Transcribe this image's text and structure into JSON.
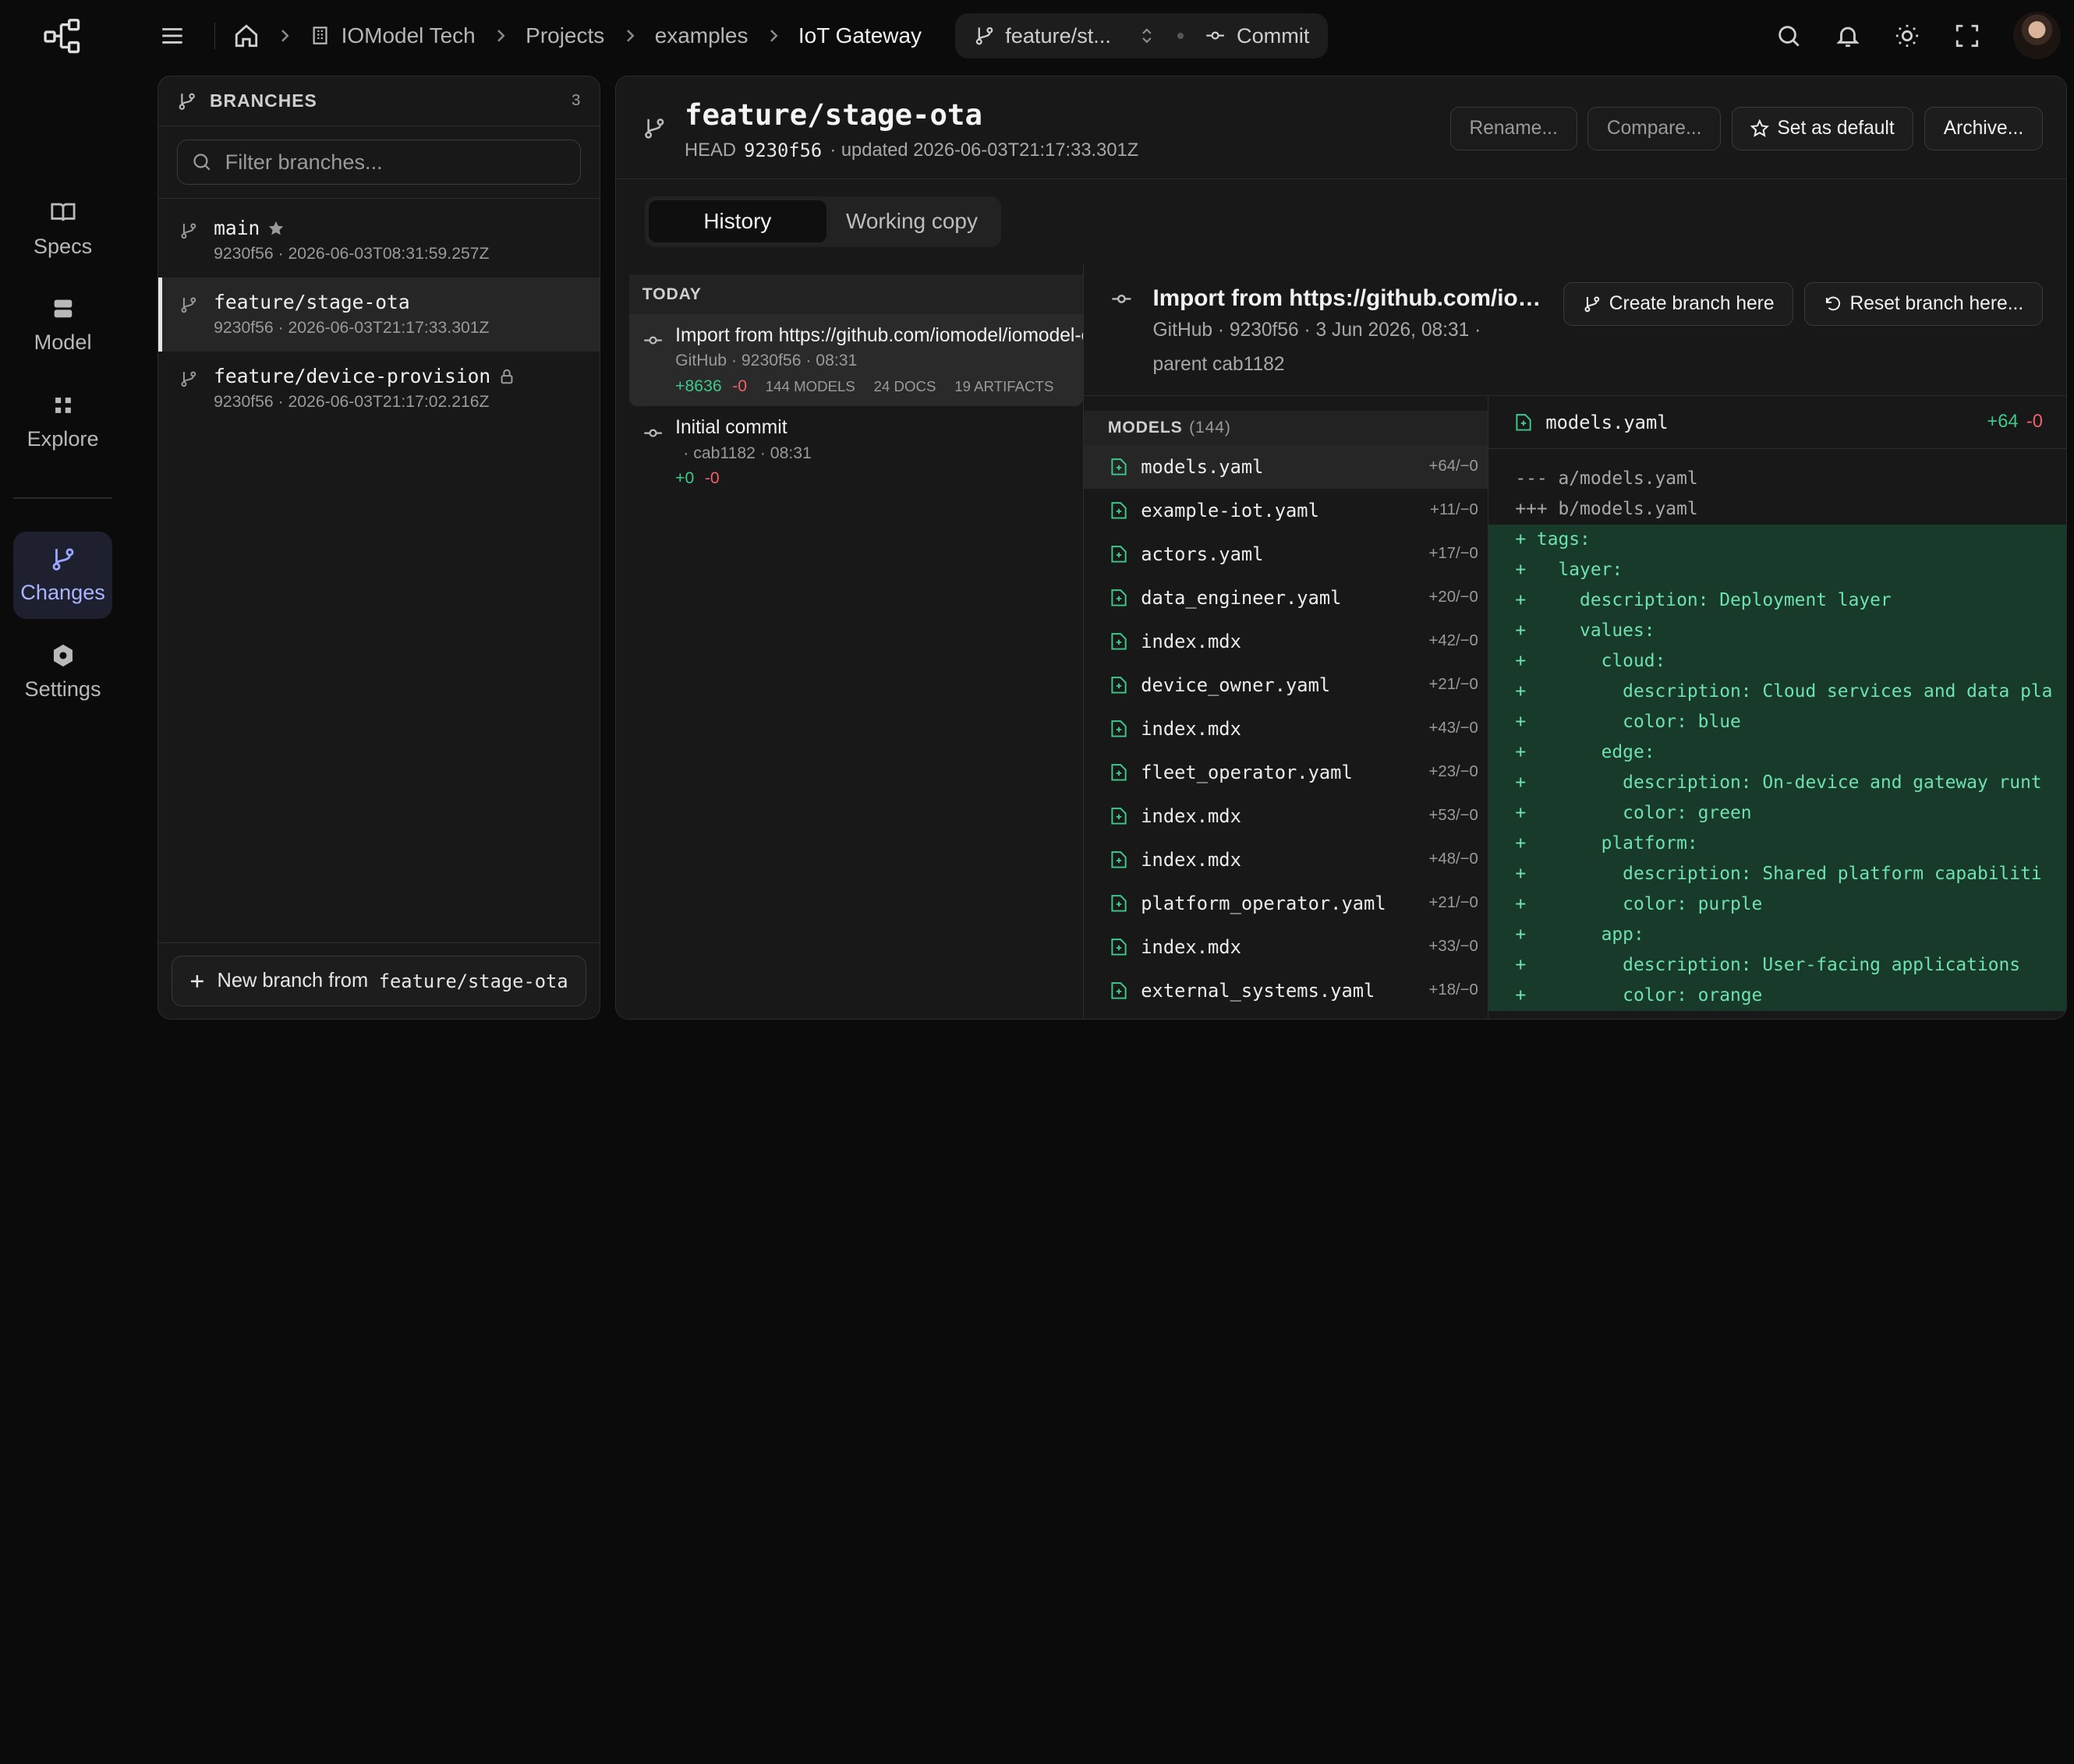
{
  "rail": {
    "items": [
      {
        "label": "Specs",
        "icon": "book-icon"
      },
      {
        "label": "Model",
        "icon": "model-icon"
      },
      {
        "label": "Explore",
        "icon": "grid-icon"
      },
      {
        "label": "Changes",
        "icon": "git-branch-icon",
        "active": true
      },
      {
        "label": "Settings",
        "icon": "hexagon-gear-icon"
      }
    ]
  },
  "topbar": {
    "breadcrumbs": [
      "IOModel Tech",
      "Projects",
      "examples",
      "IoT Gateway"
    ],
    "branch_pill": "feature/st...",
    "commit_label": "Commit"
  },
  "branches": {
    "title": "BRANCHES",
    "count": "3",
    "filter_placeholder": "Filter branches...",
    "items": [
      {
        "name": "main",
        "meta": "9230f56 · 2026-06-03T08:31:59.257Z",
        "badge": "star-icon"
      },
      {
        "name": "feature/stage-ota",
        "meta": "9230f56 · 2026-06-03T21:17:33.301Z",
        "active": true
      },
      {
        "name": "feature/device-provision",
        "meta": "9230f56 · 2026-06-03T21:17:02.216Z",
        "badge": "lock-icon"
      }
    ],
    "new_branch_label": "New branch from",
    "new_branch_ref": "feature/stage-ota"
  },
  "header": {
    "title": "feature/stage-ota",
    "head_label": "HEAD",
    "head_sha": "9230f56",
    "updated": "· updated 2026-06-03T21:17:33.301Z",
    "actions": {
      "rename": "Rename...",
      "compare": "Compare...",
      "set_default": "Set as default",
      "archive": "Archive..."
    }
  },
  "tabs": [
    "History",
    "Working copy"
  ],
  "history": {
    "group": "TODAY",
    "commits": [
      {
        "title": "Import from https://github.com/iomodel/iomodel-examples",
        "meta": "GitHub  ·  9230f56  ·  08:31",
        "plus": "+8636",
        "minus": "-0",
        "tags": [
          "144 MODELS",
          "24 DOCS",
          "19 ARTIFACTS"
        ]
      },
      {
        "title": "Initial commit",
        "meta": "·  cab1182  ·  08:31",
        "plus": "+0",
        "minus": "-0"
      }
    ]
  },
  "commit_detail": {
    "title": "Import from https://github.com/iomodel/iomodel-examples",
    "meta": "GitHub  ·  9230f56  ·  3 Jun 2026, 08:31  ·",
    "parent": "parent cab1182",
    "create_branch": "Create branch here",
    "reset_branch": "Reset branch here..."
  },
  "files": {
    "title": "MODELS",
    "count": "(144)",
    "items": [
      {
        "name": "models.yaml",
        "stat": "+64/−0",
        "active": true
      },
      {
        "name": "example-iot.yaml",
        "stat": "+11/−0"
      },
      {
        "name": "actors.yaml",
        "stat": "+17/−0"
      },
      {
        "name": "data_engineer.yaml",
        "stat": "+20/−0"
      },
      {
        "name": "index.mdx",
        "stat": "+42/−0"
      },
      {
        "name": "device_owner.yaml",
        "stat": "+21/−0"
      },
      {
        "name": "index.mdx",
        "stat": "+43/−0"
      },
      {
        "name": "fleet_operator.yaml",
        "stat": "+23/−0"
      },
      {
        "name": "index.mdx",
        "stat": "+53/−0"
      },
      {
        "name": "index.mdx",
        "stat": "+48/−0"
      },
      {
        "name": "platform_operator.yaml",
        "stat": "+21/−0"
      },
      {
        "name": "index.mdx",
        "stat": "+33/−0"
      },
      {
        "name": "external_systems.yaml",
        "stat": "+18/−0"
      }
    ]
  },
  "diff": {
    "file": "models.yaml",
    "plus": "+64",
    "minus": "-0",
    "lines": [
      {
        "t": "hdr",
        "text": "--- a/models.yaml"
      },
      {
        "t": "hdr",
        "text": "+++ b/models.yaml"
      },
      {
        "t": "add",
        "text": "+ tags:"
      },
      {
        "t": "add",
        "text": "+   layer:"
      },
      {
        "t": "add",
        "text": "+     description: Deployment layer"
      },
      {
        "t": "add",
        "text": "+     values:"
      },
      {
        "t": "add",
        "text": "+       cloud:"
      },
      {
        "t": "add",
        "text": "+         description: Cloud services and data pla"
      },
      {
        "t": "add",
        "text": "+         color: blue"
      },
      {
        "t": "add",
        "text": "+       edge:"
      },
      {
        "t": "add",
        "text": "+         description: On-device and gateway runt"
      },
      {
        "t": "add",
        "text": "+         color: green"
      },
      {
        "t": "add",
        "text": "+       platform:"
      },
      {
        "t": "add",
        "text": "+         description: Shared platform capabiliti"
      },
      {
        "t": "add",
        "text": "+         color: purple"
      },
      {
        "t": "add",
        "text": "+       app:"
      },
      {
        "t": "add",
        "text": "+         description: User-facing applications"
      },
      {
        "t": "add",
        "text": "+         color: orange"
      }
    ]
  },
  "colors": {
    "accent": "#9aa8ff",
    "added": "#3ec98a",
    "removed": "#f0606a",
    "added_bg": "#173a2a"
  }
}
